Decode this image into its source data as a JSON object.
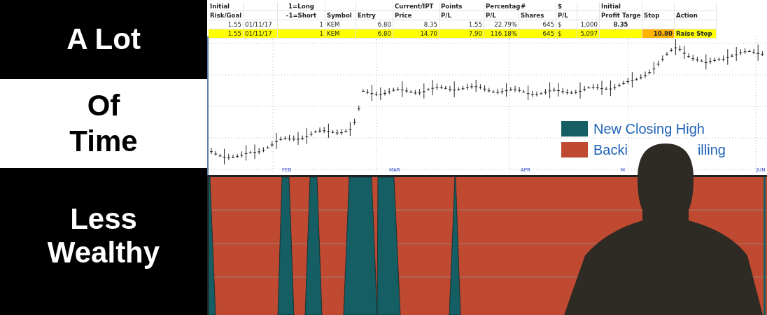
{
  "slogan": {
    "line_1": "A Lot",
    "highlight_lines": [
      "Of",
      "Time"
    ],
    "line_4": "Less",
    "line_5": "Wealthy"
  },
  "table": {
    "columns": [
      {
        "line1": "Initial",
        "line2": "Risk/Goal"
      },
      {},
      {
        "line1": "1=Long",
        "line2": "-1=Short"
      },
      {
        "line2": "Symbol"
      },
      {
        "line2": "Entry"
      },
      {
        "line1": "Current/IPT",
        "line2": "Price"
      },
      {
        "line1": "Points",
        "line2": "P/L"
      },
      {
        "line1": "Percentag",
        "line2": "P/L"
      },
      {
        "line1": "#",
        "line2": "Shares"
      },
      {
        "line1": "$",
        "line2": "P/L"
      },
      {},
      {
        "line1": "Initial",
        "line2": "Profit Targe"
      },
      {
        "line2": "Stop"
      },
      {
        "line2": "Action"
      }
    ],
    "rows": [
      {
        "highlighted": false,
        "stop_alert": false,
        "cells": [
          "1.55",
          "01/11/17",
          "1",
          "KEM",
          "6.80",
          "8.35",
          "1.55",
          "22.79%",
          "645",
          "$",
          "1,000",
          "8.35",
          null,
          null
        ]
      },
      {
        "highlighted": true,
        "stop_alert": true,
        "cells": [
          "1.55",
          "01/11/17",
          "1",
          "KEM",
          "6.80",
          "14.70",
          "7.90",
          "116.18%",
          "645",
          "$",
          "5,097",
          null,
          "10.80",
          "Raise Stop"
        ]
      }
    ]
  },
  "price_chart": {
    "x_labels": [
      "FEB",
      "MAR",
      "APR",
      "M",
      "JUN"
    ]
  },
  "legend": [
    {
      "color": "#155e63",
      "label_parts": [
        "New Closing High"
      ]
    },
    {
      "color": "#c04a31",
      "label_parts": [
        "Backi",
        "illing"
      ]
    }
  ]
}
